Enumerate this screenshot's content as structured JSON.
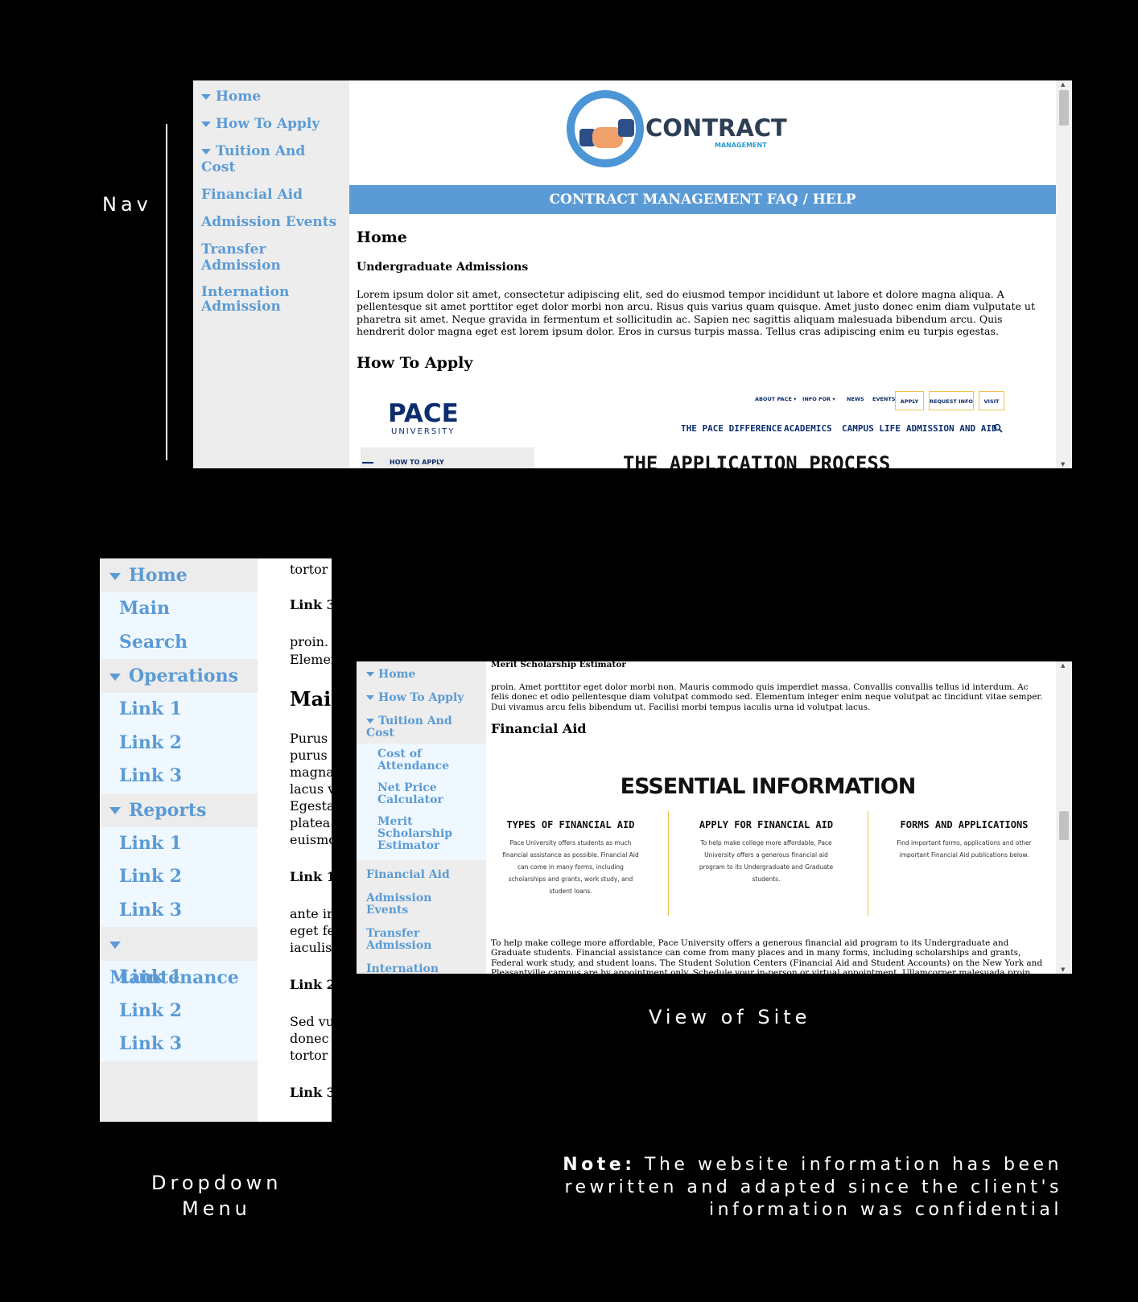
{
  "captions": {
    "nav": "Nav",
    "view_of_site": "View of Site",
    "dropdown_line1": "Dropdown",
    "dropdown_line2": "Menu",
    "note_label": "Note:",
    "note_line1": "The website information has been",
    "note_line2": "rewritten and adapted since the client's",
    "note_line3": "information was confidential"
  },
  "panel1": {
    "nav": [
      "Home",
      "How To Apply",
      "Tuition And Cost",
      "Financial Aid",
      "Admission Events",
      "Transfer Admission",
      "Internation Admission"
    ],
    "logo_text": "CONTRACT",
    "logo_sub": "MANAGEMENT",
    "banner": "CONTRACT MANAGEMENT FAQ / HELP",
    "h_home": "Home",
    "h_undergrad": "Undergraduate Admissions",
    "lorem": "Lorem ipsum dolor sit amet, consectetur adipiscing elit, sed do eiusmod tempor incididunt ut labore et dolore magna aliqua. A pellentesque sit amet porttitor eget dolor morbi non arcu. Risus quis varius quam quisque. Amet justo donec enim diam vulputate ut pharetra sit amet. Neque gravida in fermentum et sollicitudin ac. Sapien nec sagittis aliquam malesuada bibendum arcu. Quis hendrerit dolor magna eget est lorem ipsum dolor. Eros in cursus turpis massa. Tellus cras adipiscing enim eu turpis egestas.",
    "h_howto": "How To Apply",
    "pace": {
      "logo": "PACE",
      "university": "UNIVERSITY",
      "top_nav": [
        "ABOUT PACE ▾",
        "INFO FOR ▾",
        "NEWS",
        "EVENTS"
      ],
      "top_buttons": [
        "APPLY",
        "REQUEST INFO",
        "VISIT"
      ],
      "main_nav": [
        "THE PACE DIFFERENCE",
        "ACADEMICS",
        "CAMPUS LIFE",
        "ADMISSION AND AID"
      ],
      "side_item": "HOW TO APPLY",
      "title": "THE APPLICATION PROCESS"
    }
  },
  "panel2": {
    "groups": [
      {
        "label": "Home",
        "items": [
          "Main",
          "Search"
        ]
      },
      {
        "label": "Operations",
        "items": [
          "Link 1",
          "Link 2",
          "Link 3"
        ]
      },
      {
        "label": "Reports",
        "items": [
          "Link 1",
          "Link 2",
          "Link 3"
        ]
      },
      {
        "label": "Maintenance",
        "items": [
          "Link 1",
          "Link 2",
          "Link 3"
        ]
      }
    ],
    "content": [
      "tortor i",
      "Link 3",
      "proin. A",
      "Elemen",
      "Mai",
      "Purus i",
      "purus s",
      "magna",
      "lacus v",
      "Egestas",
      "platea d",
      "euismo",
      "Link 1",
      "ante in",
      "eget fe",
      "iaculis",
      "Link 2",
      "Sed vu",
      "donec r",
      "tortor i",
      "Link 3"
    ]
  },
  "panel3": {
    "nav_top": [
      "Home",
      "How To Apply",
      "Tuition And Cost"
    ],
    "sub": [
      "Cost of Attendance",
      "Net Price Calculator",
      "Merit Scholarship Estimator"
    ],
    "nav_bottom": [
      "Financial Aid",
      "Admission Events",
      "Transfer Admission",
      "Internation Admission"
    ],
    "merit_heading": "Merit Scholarship Estimator",
    "proin": "proin. Amet porttitor eget dolor morbi non. Mauris commodo quis imperdiet massa. Convallis convallis tellus id interdum. Ac felis donec et odio pellentesque diam volutpat commodo sed. Elementum integer enim neque volutpat ac tincidunt vitae semper. Dui vivamus arcu felis bibendum ut. Facilisi morbi tempus iaculis urna id volutpat lacus.",
    "fa_heading": "Financial Aid",
    "essential": "ESSENTIAL INFORMATION",
    "columns": [
      {
        "title": "TYPES OF FINANCIAL AID",
        "text": "Pace University offers students as much financial assistance as possible. Financial Aid can come in many forms, including scholarships and grants, work study, and student loans."
      },
      {
        "title": "APPLY FOR FINANCIAL AID",
        "text": "To help make college more affordable, Pace University offers a generous financial aid program to its Undergraduate and Graduate students."
      },
      {
        "title": "FORMS AND APPLICATIONS",
        "text": "Find important forms, applications and other important Financial Aid publications below."
      }
    ],
    "bottom_text": "To help make college more affordable, Pace University offers a generous financial aid program to its Undergraduate and Graduate students. Financial assistance can come from many places and in many forms, including scholarships and grants, Federal work study, and student loans. The Student Solution Centers (Financial Aid and Student Accounts) on the New York and Pleasantville campus are by appointment only. Schedule your in-person or virtual appointment. Ullamcorper malesuada proin libero nunc consequat interdum varius sit amet. Sit amet consectetur adipiscing."
  },
  "colors": {
    "accent": "#5b9bd5",
    "sidebar": "#ededed",
    "submenu": "#f0f8ff",
    "pace_navy": "#0d2d6e",
    "pace_gold": "#f2c14e"
  }
}
